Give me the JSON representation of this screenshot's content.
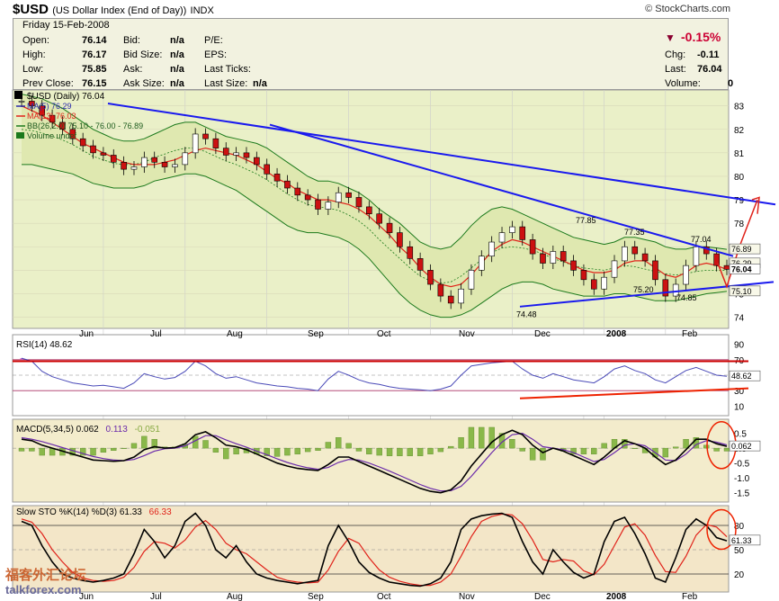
{
  "header": {
    "symbol": "$USD",
    "name": "(US Dollar Index (End of Day))",
    "exchange": "INDX",
    "brand": "© StockCharts.com"
  },
  "quote": {
    "date": "Friday  15-Feb-2008",
    "open_label": "Open:",
    "open": "76.14",
    "high_label": "High:",
    "high": "76.17",
    "low_label": "Low:",
    "low": "75.85",
    "prev_label": "Prev Close:",
    "prev": "76.15",
    "bid_label": "Bid:",
    "bid": "n/a",
    "bidsize_label": "Bid Size:",
    "bidsize": "n/a",
    "ask_label": "Ask:",
    "ask": "n/a",
    "asksize_label": "Ask Size:",
    "asksize": "n/a",
    "pe_label": "P/E:",
    "eps_label": "EPS:",
    "lastticks_label": "Last Ticks:",
    "lastsize_label": "Last Size:",
    "lastsize": "n/a",
    "pct": "-0.15%",
    "chg_label": "Chg:",
    "chg": "-0.11",
    "last_label": "Last:",
    "last": "76.04",
    "vol_label": "Volume:",
    "vol": "0"
  },
  "watermark": {
    "line1": "福客外汇论坛",
    "line2": "talkforex.com"
  },
  "chart_data": [
    {
      "type": "candlestick",
      "legend": [
        "$USD (Daily) 76.04",
        "MA(5) 76.29",
        "MA(13) 76.03",
        "BB(26,2.0) 75.10 - 76.00 - 76.89",
        "Volume undef"
      ],
      "x_ticks": [
        "Jun",
        "Jul",
        "Aug",
        "Sep",
        "Oct",
        "Nov",
        "Dec",
        "2008",
        "Feb"
      ],
      "y_ticks": [
        74,
        75,
        76,
        77,
        78,
        79,
        80,
        81,
        82,
        83
      ],
      "ylim": [
        73.6,
        83.6
      ],
      "annotations": [
        "74.48",
        "77.85",
        "77.35",
        "75.20",
        "77.04",
        "74.85"
      ],
      "right_labels": [
        "76.89",
        "76.29",
        "76.04",
        "75.10"
      ],
      "price": [
        83.2,
        83.0,
        82.6,
        82.3,
        82.0,
        81.6,
        81.3,
        81.0,
        80.9,
        80.6,
        80.3,
        80.4,
        80.8,
        80.6,
        80.4,
        80.5,
        81.0,
        81.8,
        81.6,
        81.2,
        80.9,
        81.0,
        80.8,
        80.5,
        80.1,
        79.8,
        79.5,
        79.2,
        79.0,
        78.6,
        78.9,
        79.3,
        79.1,
        78.7,
        78.4,
        78.0,
        77.6,
        77.0,
        76.5,
        76.0,
        75.4,
        74.9,
        74.6,
        75.2,
        76.0,
        76.6,
        77.2,
        77.6,
        77.85,
        77.3,
        76.7,
        76.3,
        76.8,
        76.4,
        76.0,
        75.6,
        75.2,
        75.7,
        76.4,
        77.0,
        76.7,
        76.4,
        75.6,
        74.9,
        75.4,
        76.2,
        77.0,
        76.7,
        76.2,
        76.04
      ],
      "ma13": [
        83.0,
        82.8,
        82.6,
        82.3,
        82.0,
        81.7,
        81.4,
        81.2,
        81.0,
        80.8,
        80.6,
        80.5,
        80.5,
        80.5,
        80.6,
        80.7,
        80.9,
        81.1,
        81.2,
        81.1,
        81.0,
        80.9,
        80.7,
        80.5,
        80.2,
        79.9,
        79.7,
        79.4,
        79.2,
        79.0,
        79.0,
        78.9,
        78.8,
        78.6,
        78.3,
        77.9,
        77.5,
        77.0,
        76.6,
        76.1,
        75.7,
        75.4,
        75.3,
        75.4,
        75.8,
        76.3,
        76.8,
        77.1,
        77.3,
        77.2,
        77.0,
        76.8,
        76.6,
        76.4,
        76.2,
        76.0,
        75.9,
        75.9,
        76.0,
        76.3,
        76.4,
        76.4,
        76.1,
        75.8,
        75.7,
        75.9,
        76.2,
        76.3,
        76.2,
        76.03
      ],
      "bb_upper": [
        83.5,
        83.4,
        83.3,
        83.1,
        82.9,
        82.6,
        82.3,
        82.0,
        81.8,
        81.6,
        81.5,
        81.5,
        81.6,
        81.8,
        82.0,
        82.2,
        82.3,
        82.3,
        82.1,
        81.9,
        81.7,
        81.6,
        81.5,
        81.4,
        81.2,
        80.9,
        80.6,
        80.3,
        80.0,
        79.8,
        79.8,
        79.7,
        79.5,
        79.3,
        79.0,
        78.6,
        78.3,
        78.0,
        77.6,
        77.2,
        77.0,
        76.9,
        77.0,
        77.4,
        77.9,
        78.3,
        78.6,
        78.7,
        78.6,
        78.4,
        78.2,
        78.0,
        77.8,
        77.6,
        77.4,
        77.3,
        77.2,
        77.1,
        77.2,
        77.4,
        77.4,
        77.3,
        77.2,
        77.0,
        76.9,
        76.9,
        77.0,
        77.0,
        76.95,
        76.89
      ],
      "bb_lower": [
        80.5,
        80.5,
        80.4,
        80.3,
        80.2,
        80.1,
        79.9,
        79.7,
        79.6,
        79.5,
        79.5,
        79.5,
        79.6,
        79.8,
        79.9,
        80.0,
        80.1,
        80.1,
        80.0,
        79.8,
        79.6,
        79.4,
        79.1,
        78.8,
        78.5,
        78.2,
        77.9,
        77.7,
        77.6,
        77.6,
        77.5,
        77.4,
        77.2,
        76.9,
        76.5,
        76.0,
        75.5,
        75.0,
        74.6,
        74.3,
        74.1,
        74.0,
        74.0,
        74.1,
        74.3,
        74.6,
        74.9,
        75.2,
        75.4,
        75.5,
        75.5,
        75.4,
        75.2,
        75.1,
        75.0,
        74.9,
        74.9,
        74.9,
        75.0,
        75.0,
        74.9,
        74.8,
        74.7,
        74.7,
        74.7,
        74.8,
        74.9,
        75.0,
        75.05,
        75.1
      ]
    },
    {
      "type": "line",
      "legend": "RSI(14) 48.62",
      "y_ticks": [
        10,
        30,
        50,
        70,
        90
      ],
      "ylim": [
        0,
        100
      ],
      "last": "48.62",
      "values": [
        72,
        68,
        55,
        48,
        44,
        40,
        38,
        36,
        37,
        35,
        33,
        40,
        52,
        48,
        45,
        47,
        55,
        68,
        62,
        52,
        46,
        48,
        44,
        40,
        38,
        36,
        35,
        33,
        32,
        30,
        45,
        55,
        50,
        44,
        40,
        38,
        35,
        33,
        32,
        31,
        30,
        32,
        36,
        50,
        62,
        64,
        66,
        67,
        68,
        58,
        50,
        46,
        52,
        48,
        44,
        42,
        40,
        48,
        58,
        62,
        56,
        52,
        44,
        40,
        48,
        56,
        60,
        55,
        50,
        48.6
      ]
    },
    {
      "type": "line",
      "legend": [
        "MACD(5,34,5) 0.062",
        "0.113",
        "-0.051"
      ],
      "y_ticks": [
        0.5,
        0.0,
        -0.5,
        -1.0,
        -1.5
      ],
      "ylim": [
        -1.75,
        0.85
      ],
      "last": "0.062",
      "macd": [
        0.3,
        0.25,
        0.1,
        0.0,
        -0.1,
        -0.2,
        -0.3,
        -0.4,
        -0.42,
        -0.44,
        -0.42,
        -0.3,
        -0.05,
        0.05,
        0.0,
        0.02,
        0.15,
        0.45,
        0.55,
        0.35,
        0.1,
        0.05,
        -0.05,
        -0.2,
        -0.35,
        -0.5,
        -0.6,
        -0.68,
        -0.72,
        -0.75,
        -0.55,
        -0.3,
        -0.3,
        -0.45,
        -0.6,
        -0.75,
        -0.9,
        -1.05,
        -1.2,
        -1.35,
        -1.45,
        -1.5,
        -1.4,
        -1.1,
        -0.6,
        -0.2,
        0.2,
        0.45,
        0.6,
        0.45,
        0.1,
        -0.15,
        0.0,
        -0.1,
        -0.25,
        -0.4,
        -0.55,
        -0.3,
        0.0,
        0.25,
        0.15,
        0.0,
        -0.3,
        -0.55,
        -0.4,
        -0.05,
        0.3,
        0.3,
        0.15,
        0.06
      ],
      "signal": [
        0.35,
        0.3,
        0.22,
        0.12,
        0.02,
        -0.08,
        -0.18,
        -0.28,
        -0.35,
        -0.4,
        -0.42,
        -0.38,
        -0.25,
        -0.1,
        -0.02,
        0.0,
        0.08,
        0.25,
        0.42,
        0.42,
        0.28,
        0.15,
        0.03,
        -0.1,
        -0.22,
        -0.36,
        -0.48,
        -0.58,
        -0.66,
        -0.71,
        -0.65,
        -0.48,
        -0.38,
        -0.4,
        -0.5,
        -0.63,
        -0.77,
        -0.92,
        -1.07,
        -1.22,
        -1.35,
        -1.44,
        -1.43,
        -1.28,
        -0.95,
        -0.55,
        -0.15,
        0.2,
        0.45,
        0.5,
        0.3,
        0.05,
        0.0,
        -0.05,
        -0.15,
        -0.3,
        -0.45,
        -0.38,
        -0.15,
        0.1,
        0.15,
        0.08,
        -0.15,
        -0.4,
        -0.42,
        -0.2,
        0.12,
        0.25,
        0.2,
        0.11
      ]
    },
    {
      "type": "line",
      "legend": [
        "Slow STO %K(14) %D(3) 61.33",
        "66.33"
      ],
      "y_ticks": [
        80,
        50,
        20
      ],
      "ylim": [
        0,
        100
      ],
      "last": "61.33",
      "k": [
        85,
        80,
        55,
        35,
        20,
        15,
        12,
        10,
        12,
        15,
        20,
        45,
        75,
        60,
        40,
        55,
        85,
        95,
        80,
        50,
        40,
        55,
        35,
        20,
        15,
        12,
        10,
        8,
        10,
        12,
        55,
        80,
        60,
        35,
        22,
        15,
        10,
        8,
        6,
        5,
        8,
        15,
        35,
        75,
        88,
        92,
        94,
        95,
        90,
        60,
        35,
        20,
        50,
        35,
        22,
        15,
        20,
        60,
        85,
        90,
        70,
        45,
        15,
        10,
        40,
        75,
        88,
        80,
        65,
        61
      ],
      "d": [
        88,
        84,
        70,
        50,
        35,
        22,
        15,
        12,
        11,
        12,
        16,
        28,
        48,
        60,
        58,
        52,
        62,
        78,
        86,
        75,
        58,
        50,
        45,
        35,
        25,
        16,
        12,
        10,
        9,
        10,
        25,
        48,
        64,
        58,
        40,
        25,
        16,
        11,
        8,
        6,
        6,
        10,
        20,
        42,
        66,
        85,
        91,
        94,
        93,
        82,
        62,
        38,
        35,
        38,
        36,
        24,
        19,
        32,
        55,
        78,
        82,
        68,
        43,
        23,
        22,
        42,
        68,
        81,
        78,
        66
      ]
    }
  ]
}
